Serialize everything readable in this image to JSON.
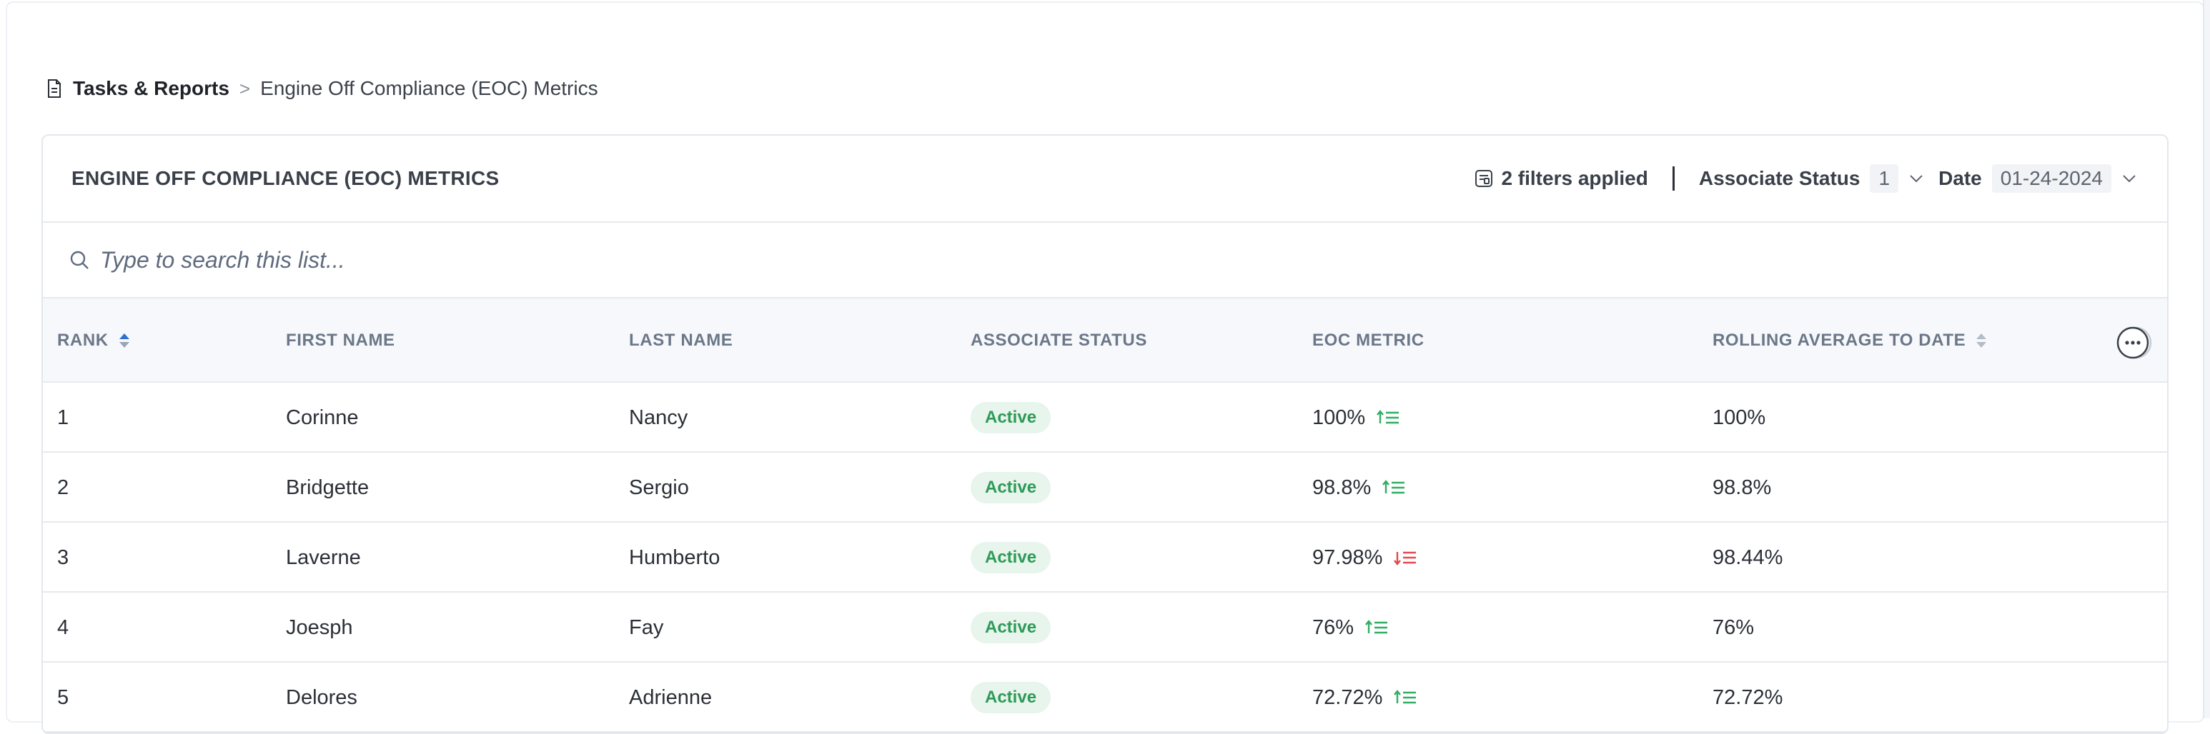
{
  "breadcrumb": {
    "root_label": "Tasks & Reports",
    "separator": ">",
    "current_label": "Engine Off Compliance (EOC) Metrics"
  },
  "card": {
    "title": "ENGINE OFF COMPLIANCE (EOC) METRICS",
    "filters": {
      "summary": "2 filters applied",
      "associate_status": {
        "label": "Associate Status",
        "value": "1"
      },
      "date": {
        "label": "Date",
        "value": "01-24-2024"
      }
    }
  },
  "search": {
    "placeholder": "Type to search this list..."
  },
  "table": {
    "columns": {
      "rank": "RANK",
      "first_name": "FIRST NAME",
      "last_name": "LAST NAME",
      "associate_status": "ASSOCIATE STATUS",
      "eoc_metric": "EOC METRIC",
      "rolling_average": "ROLLING AVERAGE TO DATE"
    },
    "rows": [
      {
        "rank": "1",
        "first_name": "Corinne",
        "last_name": "Nancy",
        "status": "Active",
        "eoc_metric": "100%",
        "trend": "up",
        "rolling_average": "100%"
      },
      {
        "rank": "2",
        "first_name": "Bridgette",
        "last_name": "Sergio",
        "status": "Active",
        "eoc_metric": "98.8%",
        "trend": "up",
        "rolling_average": "98.8%"
      },
      {
        "rank": "3",
        "first_name": "Laverne",
        "last_name": "Humberto",
        "status": "Active",
        "eoc_metric": "97.98%",
        "trend": "down",
        "rolling_average": "98.44%"
      },
      {
        "rank": "4",
        "first_name": "Joesph",
        "last_name": "Fay",
        "status": "Active",
        "eoc_metric": "76%",
        "trend": "up",
        "rolling_average": "76%"
      },
      {
        "rank": "5",
        "first_name": "Delores",
        "last_name": "Adrienne",
        "status": "Active",
        "eoc_metric": "72.72%",
        "trend": "up",
        "rolling_average": "72.72%"
      }
    ]
  },
  "colors": {
    "badge_bg": "#e7f5ec",
    "badge_text": "#2d9a57",
    "trend_up": "#2fae62",
    "trend_down": "#e5484d",
    "sort_active": "#2f6fd0"
  },
  "icons": {
    "breadcrumb": "document-icon",
    "filters": "filter-list-icon",
    "search": "search-icon",
    "sort": "sort-arrows-icon",
    "more": "more-options-icon",
    "trend_up": "trend-up-list-icon",
    "trend_down": "trend-down-list-icon"
  }
}
